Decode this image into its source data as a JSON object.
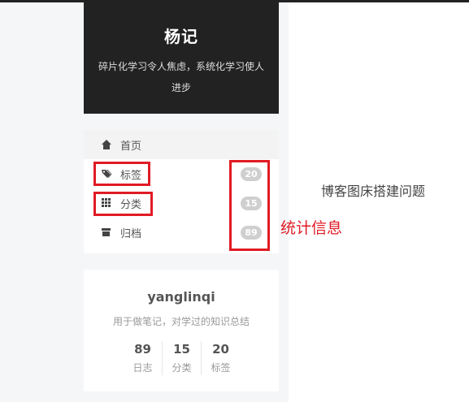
{
  "site": {
    "title": "杨记",
    "subtitle": "碎片化学习令人焦虑，系统化学习使人进步"
  },
  "menu": {
    "items": [
      {
        "label": "首页",
        "icon": "home-icon"
      },
      {
        "label": "标签",
        "icon": "tags-icon",
        "count": "20"
      },
      {
        "label": "分类",
        "icon": "grid-icon",
        "count": "15"
      },
      {
        "label": "归档",
        "icon": "archive-icon",
        "count": "89"
      }
    ]
  },
  "annotation": {
    "label": "统计信息",
    "color": "#e01b24"
  },
  "content": {
    "text": "博客图床搭建问题"
  },
  "author": {
    "name": "yanglinqi",
    "description": "用于做笔记，对学过的知识总结",
    "stats": [
      {
        "num": "89",
        "label": "日志"
      },
      {
        "num": "15",
        "label": "分类"
      },
      {
        "num": "20",
        "label": "标签"
      }
    ]
  }
}
